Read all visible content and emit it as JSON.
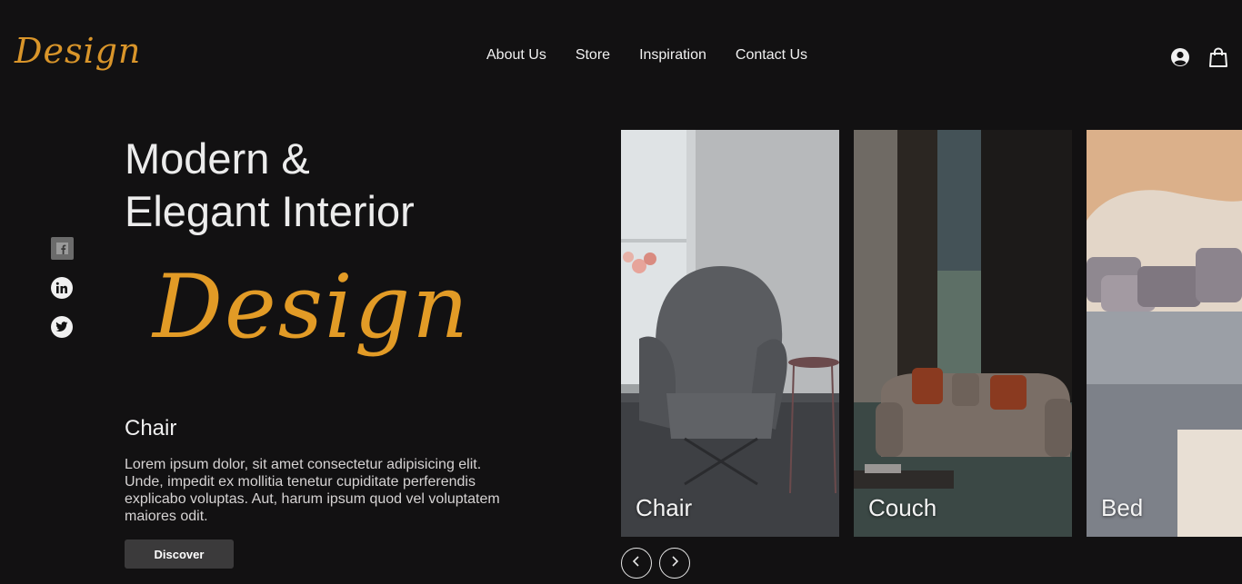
{
  "header": {
    "logo": "Design",
    "nav": [
      "About Us",
      "Store",
      "Inspiration",
      "Contact Us"
    ],
    "icons": [
      "account-icon",
      "shopping-bag-icon"
    ]
  },
  "socials": [
    "facebook-icon",
    "linkedin-icon",
    "twitter-icon"
  ],
  "hero": {
    "title_line1": "Modern &",
    "title_line2": "Elegant Interior",
    "script": "Design",
    "product_name": "Chair",
    "description": "Lorem ipsum dolor, sit amet consectetur adipisicing elit. Unde, impedit ex mollitia tenetur cupiditate perferendis explicabo voluptas. Aut, harum ipsum quod vel voluptatem maiores odit.",
    "button": "Discover"
  },
  "carousel": {
    "cards": [
      {
        "label": "Chair"
      },
      {
        "label": "Couch"
      },
      {
        "label": "Bed"
      }
    ],
    "prev_icon": "chevron-left-icon",
    "next_icon": "chevron-right-icon"
  },
  "colors": {
    "background": "#121112",
    "accent": "#e29b26",
    "text": "#ececec"
  }
}
